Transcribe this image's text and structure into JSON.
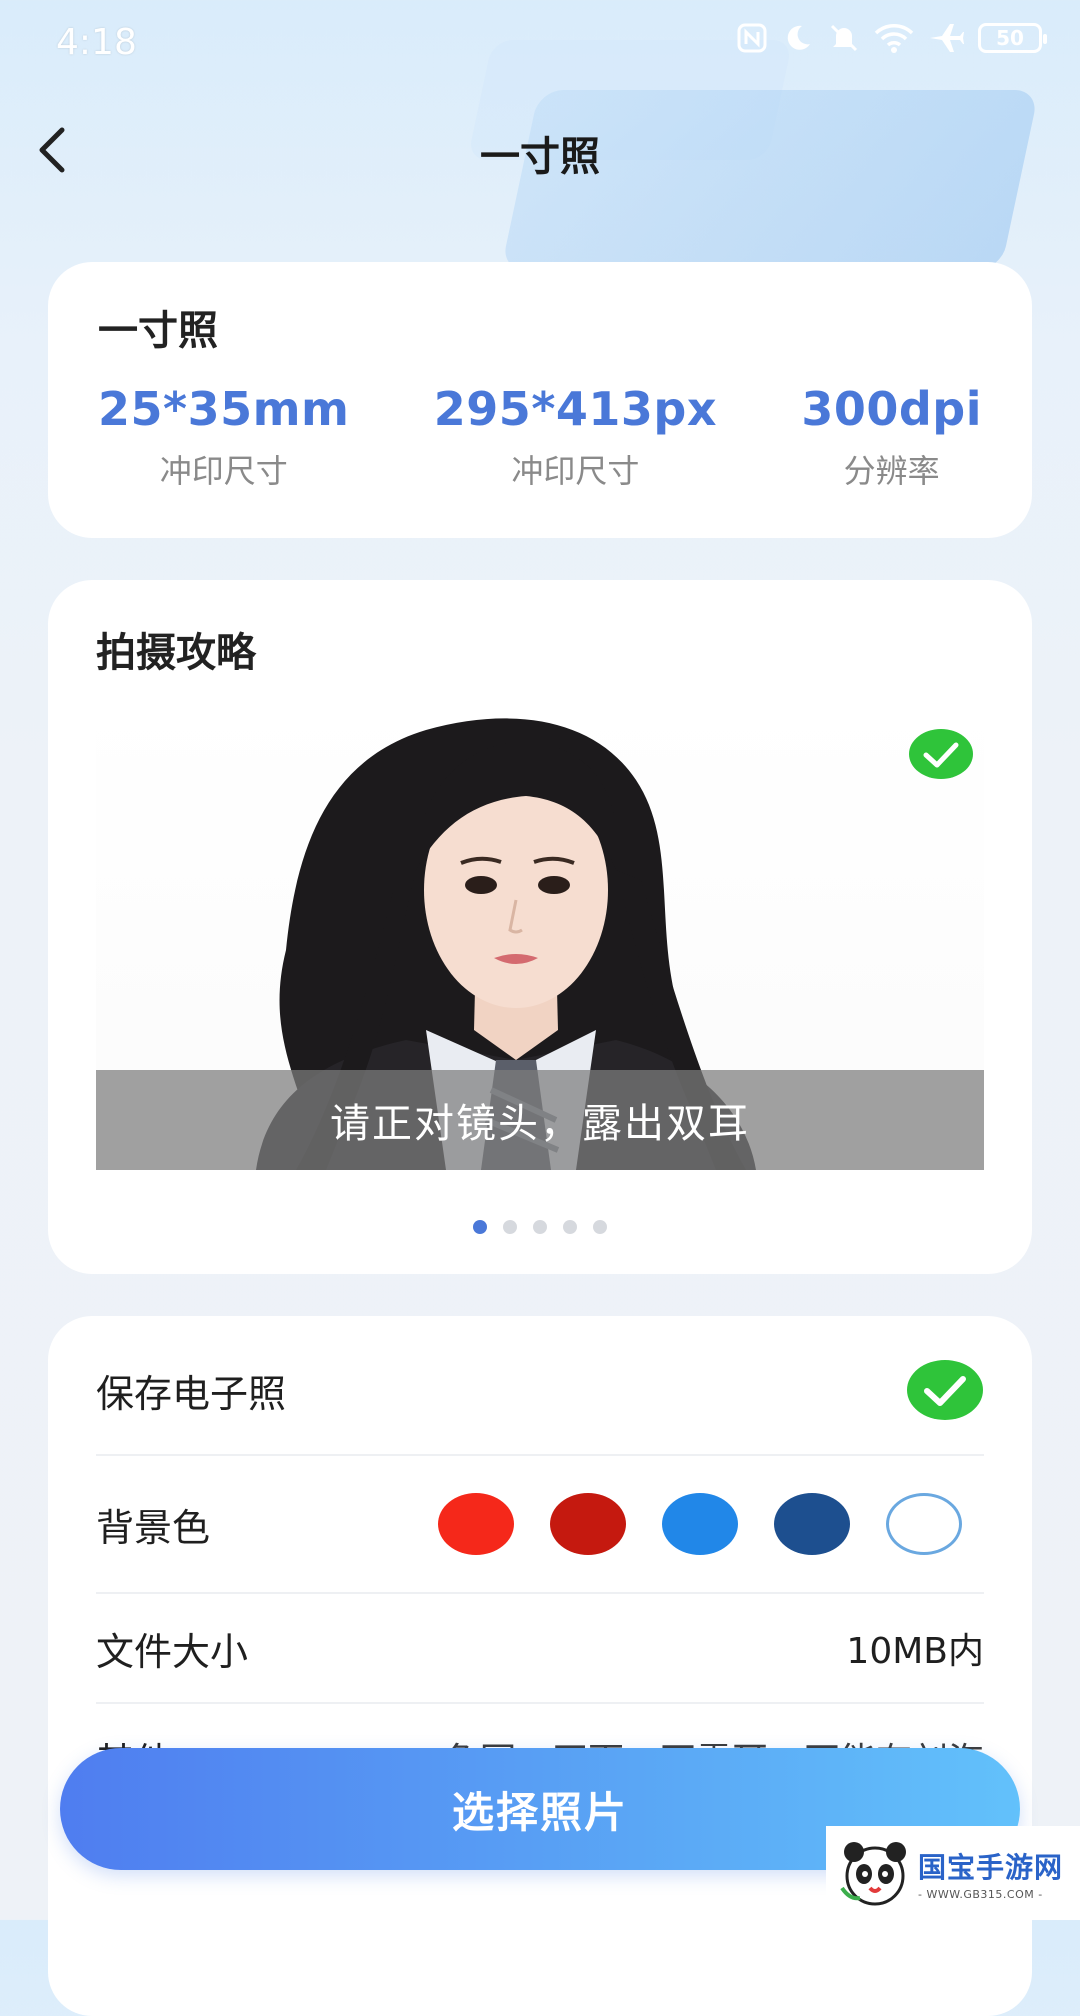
{
  "status_bar": {
    "time": "4:18",
    "battery": "50",
    "icons": [
      "nfc-icon",
      "moon-icon",
      "mute-icon",
      "wifi-icon",
      "airplane-icon",
      "battery-icon"
    ]
  },
  "header": {
    "title": "一寸照",
    "back_icon": "chevron-left-icon"
  },
  "spec_card": {
    "title": "一寸照",
    "items": [
      {
        "value": "25*35mm",
        "label": "冲印尺寸"
      },
      {
        "value": "295*413px",
        "label": "冲印尺寸"
      },
      {
        "value": "300dpi",
        "label": "分辨率"
      }
    ]
  },
  "guide_card": {
    "title": "拍摄攻略",
    "caption": "请正对镜头，露出双耳",
    "check_icon": "check-circle-icon",
    "dots_count": 5,
    "active_dot": 0
  },
  "settings": {
    "save_label": "保存电子照",
    "background_label": "背景色",
    "colors": [
      "#f5281a",
      "#c5190f",
      "#2187e8",
      "#1d4f8f",
      "#ffffff"
    ],
    "file_size_label": "文件大小",
    "file_size_value": "10MB内",
    "other_label": "其他",
    "other_value": "免冠，正面，不露耳，不能有刘海"
  },
  "select_button": {
    "label": "选择照片"
  },
  "watermark": {
    "main": "国宝手游网",
    "sub": "- WWW.GB315.COM -"
  }
}
